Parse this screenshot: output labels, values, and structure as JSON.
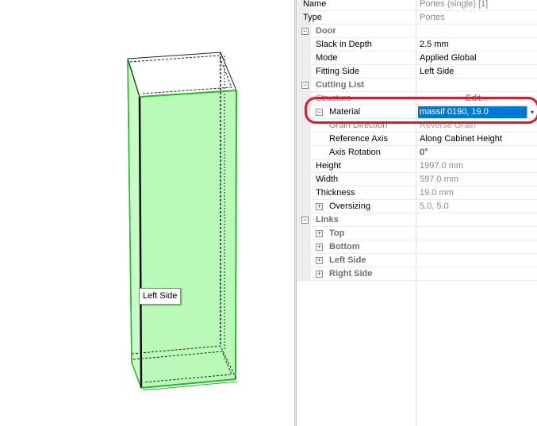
{
  "viewport": {
    "tooltip": "Left Side",
    "accent_green": "#22bb22",
    "fill_green": "#b9fab9"
  },
  "properties": {
    "rows": [
      {
        "name": "Name",
        "value": "Portes (single) [1]",
        "kind": "ro"
      },
      {
        "name": "Type",
        "value": "Portes",
        "kind": "ro"
      },
      {
        "name": "Door",
        "kind": "cat",
        "expander": "−"
      },
      {
        "name": "Slack in Depth",
        "value": "2.5 mm"
      },
      {
        "name": "Mode",
        "value": "Applied Global"
      },
      {
        "name": "Fitting Side",
        "value": "Left Side"
      },
      {
        "name": "Cutting List",
        "kind": "cat",
        "expander": "−"
      },
      {
        "name": "Structure",
        "value": "Edit...",
        "kind": "hidden"
      },
      {
        "name": "Material",
        "value": "massif 0190, 19.0",
        "kind": "selected",
        "expander": "−"
      },
      {
        "name": "Grain Direction",
        "value": "Reverse Grain",
        "kind": "hidden2"
      },
      {
        "name": "Reference Axis",
        "value": "Along Cabinet Height"
      },
      {
        "name": "Axis Rotation",
        "value": "0°"
      },
      {
        "name": "Height",
        "value": "1997.0 mm",
        "kind": "ro"
      },
      {
        "name": "Width",
        "value": "597.0 mm",
        "kind": "ro"
      },
      {
        "name": "Thickness",
        "value": "19.0 mm",
        "kind": "ro"
      },
      {
        "name": "Oversizing",
        "value": "5.0, 5.0",
        "kind": "ro",
        "expander": "+"
      },
      {
        "name": "Links",
        "kind": "cat",
        "expander": "−"
      },
      {
        "name": "Top",
        "kind": "sub",
        "expander": "+"
      },
      {
        "name": "Bottom",
        "kind": "sub",
        "expander": "+"
      },
      {
        "name": "Left Side",
        "kind": "sub",
        "expander": "+"
      },
      {
        "name": "Right Side",
        "kind": "sub",
        "expander": "+"
      }
    ],
    "selection_color": "#0078d7",
    "highlight_color": "#e0182b"
  }
}
